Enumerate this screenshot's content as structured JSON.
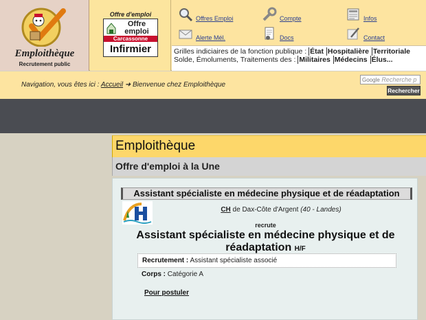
{
  "logo": {
    "name": "Emploithèque",
    "subtitle": "Recrutement public"
  },
  "offre": {
    "label": "Offre d'emploi",
    "card_line1": "Offre emploi",
    "city": "Carcassonne",
    "job": "Infirmier"
  },
  "nav": {
    "items": [
      {
        "label": "Offres Emploi",
        "icon": "magnifier-icon"
      },
      {
        "label": "Compte",
        "icon": "wrench-icon"
      },
      {
        "label": "Infos",
        "icon": "newspaper-icon"
      },
      {
        "label": "Alerte Mél.",
        "icon": "envelope-icon"
      },
      {
        "label": "Docs",
        "icon": "document-icon"
      },
      {
        "label": "Contact",
        "icon": "pen-icon"
      }
    ]
  },
  "grilles": {
    "line1_prefix": "Grilles indiciaires de la fonction publique :",
    "line1_links": [
      "État",
      "Hospitalière",
      "Territoriale"
    ],
    "line2_prefix": "Solde, Émoluments, Traitements des :",
    "line2_links": [
      "Militaires",
      "Médecins",
      "Élus..."
    ]
  },
  "breadcrumb": {
    "prefix": "Navigation, vous êtes ici :",
    "home": "Accueil",
    "arrow": "➜",
    "current": "Bienvenue chez Emploithèque"
  },
  "search": {
    "brand": "Google",
    "placeholder": "Recherche p",
    "button": "Rechercher"
  },
  "content": {
    "heading": "Emploithèque",
    "subheading": "Offre d'emploi à la Une",
    "job_strip": "Assistant spécialiste en médecine physique et de réadaptation",
    "employer_abbr": "CH",
    "employer_rest": "de Dax-Côte d'Argent",
    "employer_loc": "(40 - Landes)",
    "recrute": "recrute",
    "job_title": "Assistant spécialiste en médecine physique et de réadaptation",
    "job_suffix": "H/F",
    "recrutement_label": "Recrutement :",
    "recrutement_value": "Assistant spécialiste associé",
    "corps_label": "Corps :",
    "corps_value": "Catégorie A",
    "apply": "Pour postuler"
  }
}
